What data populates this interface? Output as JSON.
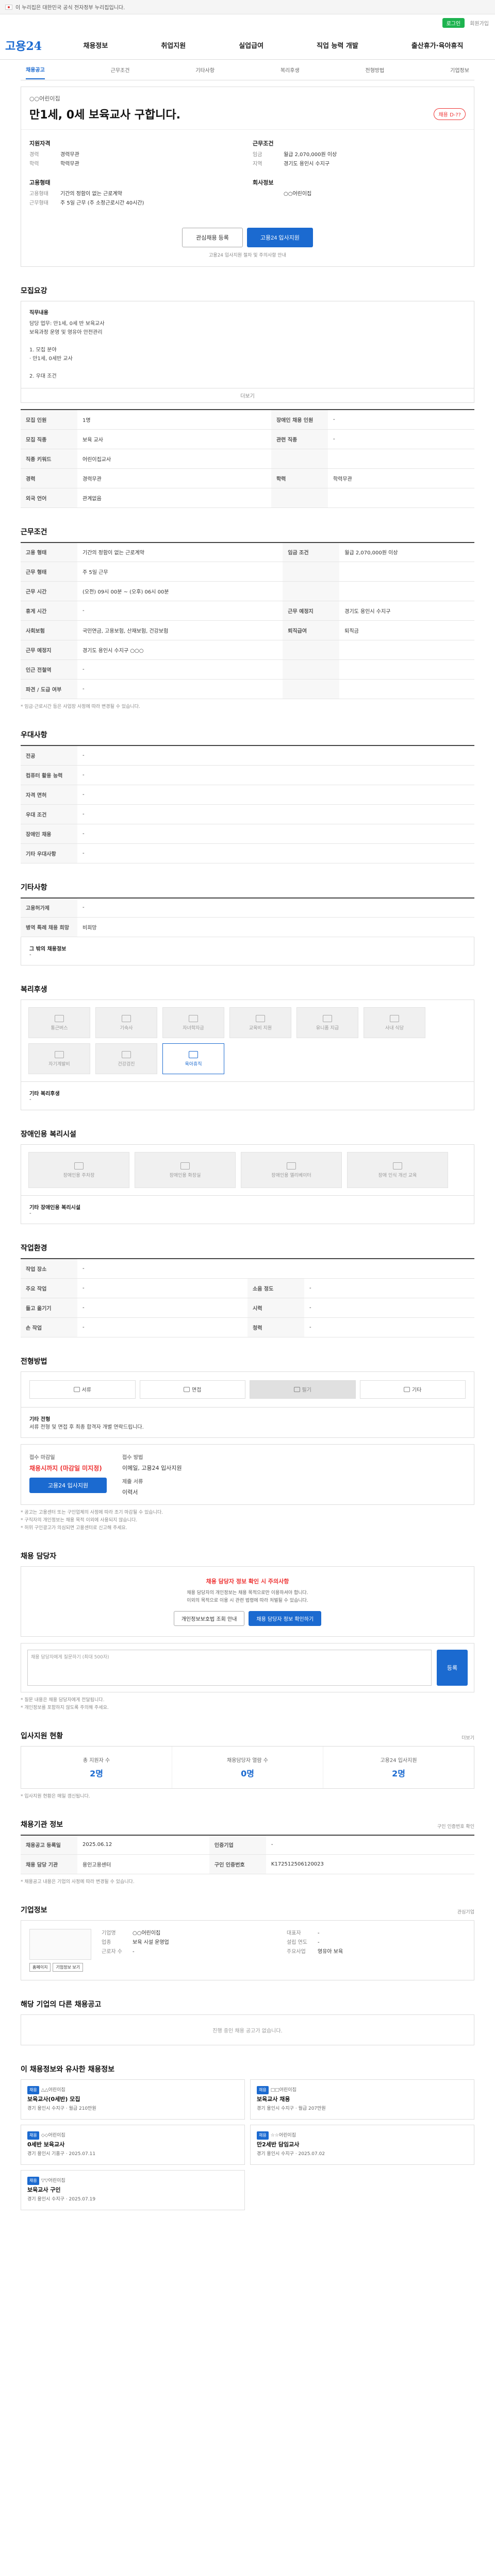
{
  "topbar": {
    "text": "이 누리집은 대한민국 공식 전자정부 누리집입니다."
  },
  "subtop": {
    "login": "로그인",
    "join": "회원가입"
  },
  "gnb": {
    "logo": "고용24",
    "menu": [
      "채용정보",
      "취업지원",
      "실업급여",
      "직업 능력 개발",
      "출산휴가·육아휴직"
    ]
  },
  "tabs": [
    "채용공고",
    "근무조건",
    "기타사항",
    "복리후생",
    "전형방법",
    "기업정보"
  ],
  "head": {
    "company": "○○어린이집",
    "title": "만1세, 0세 보육교사 구합니다.",
    "dday": "채용 D-??",
    "left_title": "지원자격",
    "left": [
      {
        "k": "경력",
        "v": "경력무관"
      },
      {
        "k": "학력",
        "v": "학력무관"
      }
    ],
    "left_title2": "고용형태",
    "left2": [
      {
        "k": "고용형태",
        "v": "기간의 정함이 없는 근로계약"
      },
      {
        "k": "근무형태",
        "v": "주 5일 근무 (주 소정근로시간 40시간)"
      }
    ],
    "right_title": "근무조건",
    "right": [
      {
        "k": "임금",
        "v": "월급 2,070,000원 이상"
      },
      {
        "k": "지역",
        "v": "경기도 용인시 수지구"
      }
    ],
    "right_title2": "회사정보",
    "right2": [
      {
        "k": "",
        "v": "○○어린이집"
      }
    ],
    "btn_interest": "관심채용 등록",
    "btn_apply": "고용24 입사지원",
    "notice": "고용24 입사지원 절차 및 주의사항 안내"
  },
  "recruit": {
    "title": "모집요강",
    "content_label": "직무내용",
    "content": [
      "담당 업무: 만1세, 0세 반 보육교사",
      "보육과정 운영 및 영유아 안전관리",
      "",
      "1. 모집 분야",
      "  · 만1세, 0세반 교사",
      "",
      "2. 우대 조건"
    ],
    "more": "더보기",
    "rows": [
      [
        {
          "th": "모집 인원",
          "td": "1명"
        },
        {
          "th": "장애인 채용 인원",
          "td": "-"
        }
      ],
      [
        {
          "th": "모집 직종",
          "td": "보육 교사"
        },
        {
          "th": "관련 직종",
          "td": "-"
        }
      ],
      [
        {
          "th": "직종 키워드",
          "td": "어린이집교사"
        },
        {
          "th": "",
          "td": ""
        }
      ],
      [
        {
          "th": "경력",
          "td": "경력무관"
        },
        {
          "th": "학력",
          "td": "학력무관"
        }
      ],
      [
        {
          "th": "외국 언어",
          "td": "관계없음"
        },
        {
          "th": "",
          "td": ""
        }
      ]
    ]
  },
  "conditions": {
    "title": "근무조건",
    "rows": [
      [
        {
          "th": "고용 형태",
          "td": "기간의 정함이 없는 근로계약"
        },
        {
          "th": "임금 조건",
          "td": "월급 2,070,000원 이상"
        }
      ],
      [
        {
          "th": "근무 형태",
          "td": "주 5일 근무"
        },
        {
          "th": "",
          "td": ""
        }
      ],
      [
        {
          "th": "근무 시간",
          "td": "(오전) 09시 00분 ~ (오후) 06시 00분"
        },
        {
          "th": "",
          "td": ""
        }
      ],
      [
        {
          "th": "휴게 시간",
          "td": "-"
        },
        {
          "th": "근무 예정지",
          "td": "경기도 용인시 수지구"
        }
      ],
      [
        {
          "th": "사회보험",
          "td": "국민연금, 고용보험, 산재보험, 건강보험"
        },
        {
          "th": "퇴직급여",
          "td": "퇴직금"
        }
      ],
      [
        {
          "th": "근무 예정지",
          "td": "경기도 용인시 수지구 ○○○"
        },
        {
          "th": "",
          "td": ""
        }
      ],
      [
        {
          "th": "인근 전철역",
          "td": "-"
        },
        {
          "th": "",
          "td": ""
        }
      ],
      [
        {
          "th": "파견 / 도급 여부",
          "td": "-"
        },
        {
          "th": "",
          "td": ""
        }
      ]
    ],
    "tag": "주 5일 근무",
    "note": "주 소정근로시간 40시간",
    "footnote": "* 임금·근로시간 등은 사업장 사정에 따라 변경될 수 있습니다."
  },
  "etc": {
    "title": "우대사항",
    "rows": [
      [
        {
          "th": "전공",
          "td": "-"
        }
      ],
      [
        {
          "th": "컴퓨터 활용 능력",
          "td": "-"
        }
      ],
      [
        {
          "th": "자격 면허",
          "td": "-"
        }
      ],
      [
        {
          "th": "우대 조건",
          "td": "-"
        }
      ],
      [
        {
          "th": "장애인 채용",
          "td": "-"
        }
      ],
      [
        {
          "th": "기타 우대사항",
          "td": "-"
        }
      ]
    ]
  },
  "other": {
    "title": "기타사항",
    "rows": [
      [
        {
          "th": "고용허가제",
          "td": "-"
        }
      ],
      [
        {
          "th": "병역 특례 채용 희망",
          "td": "비희망"
        }
      ]
    ],
    "subtitle": "그 밖의 채용정보",
    "subvalue": "-"
  },
  "welfare": {
    "title": "복리후생",
    "tiles": [
      "통근버스",
      "기숙사",
      "자녀학자금",
      "교육비 지원",
      "유니폼 지급",
      "사내 식당",
      "자기계발비",
      "건강검진",
      "육아휴직"
    ],
    "active_index": 8,
    "extra_label": "기타 복리후생",
    "extra_value": "-"
  },
  "disabled": {
    "title": "장애인용 복리시설",
    "tiles": [
      "장애인용 주차장",
      "장애인용 화장실",
      "장애인용 엘리베이터",
      "장애 인식 개선 교육"
    ],
    "note_label": "기타 장애인용 복리시설",
    "note_value": "-"
  },
  "env": {
    "title": "작업환경",
    "rows": [
      [
        {
          "th": "작업 장소",
          "td": "-"
        }
      ],
      [
        {
          "th": "주요 작업",
          "td": "-"
        },
        {
          "th": "소음 정도",
          "td": "-"
        }
      ],
      [
        {
          "th": "들고 옮기기",
          "td": "-"
        },
        {
          "th": "시력",
          "td": "-"
        }
      ],
      [
        {
          "th": "손 작업",
          "td": "-"
        },
        {
          "th": "청력",
          "td": "-"
        }
      ]
    ]
  },
  "process": {
    "title": "전형방법",
    "steps": [
      "서류",
      "면접",
      "필기",
      "기타"
    ],
    "current": 2,
    "method_label": "기타 전형",
    "method_value": "서류 전형 및 면접 후 최종 합격자 개별 연락드립니다.",
    "apply_label": "접수 마감일",
    "apply_date": "채용시까지 (마감일 미지정)",
    "apply_method_label": "접수 방법",
    "apply_method": "이메일, 고용24 입사지원",
    "doc_label": "제출 서류",
    "doc_value": "이력서",
    "apply_btn": "고용24 입사지원",
    "notes": [
      "* 공고는 고용센터 또는 구인업체의 사정에 따라 조기 마감될 수 있습니다.",
      "* 구직자의 개인정보는 채용 목적 이외에 사용되지 않습니다.",
      "* 허위 구인광고가 의심되면 고용센터로 신고해 주세요."
    ]
  },
  "manager": {
    "title": "채용 담당자",
    "warn": "채용 담당자 정보 확인 시 주의사항",
    "desc": [
      "채용 담당자의 개인정보는 채용 목적으로만 이용하셔야 합니다.",
      "이외의 목적으로 이용 시 관련 법령에 따라 처벌될 수 있습니다."
    ],
    "btn1": "개인정보보호법 조회 안내",
    "btn2": "채용 담당자 정보 확인하기"
  },
  "qa": {
    "placeholder": "채용 담당자에게 질문하기 (최대 500자)",
    "send": "등록",
    "notes": [
      "* 질문 내용은 채용 담당자에게 전달됩니다.",
      "* 개인정보를 포함하지 않도록 주의해 주세요."
    ]
  },
  "status": {
    "title": "입사지원 현황",
    "more": "더보기",
    "items": [
      {
        "lbl": "총 지원자 수",
        "num": "2명"
      },
      {
        "lbl": "채용담당자 열람 수",
        "num": "0명"
      },
      {
        "lbl": "고용24 입사지원",
        "num": "2명"
      }
    ],
    "footnote": "* 입사지원 현황은 매일 갱신됩니다."
  },
  "meta": {
    "title": "채용기관 정보",
    "more": "구인 인증번호 확인",
    "rows": [
      [
        {
          "th": "채용공고 등록일",
          "td": "2025.06.12"
        },
        {
          "th": "인증기업",
          "td": "-"
        }
      ],
      [
        {
          "th": "채용 담당 기관",
          "td": "용인고용센터"
        },
        {
          "th": "구인 인증번호",
          "td": "K172512506120023"
        }
      ]
    ],
    "footnote": "* 채용공고 내용은 기업의 사정에 따라 변경될 수 있습니다."
  },
  "corp": {
    "title": "기업정보",
    "btn_home": "홈페이지",
    "btn_more": "기업정보 보기",
    "btn_fav": "관심기업",
    "cols": [
      [
        {
          "k": "기업명",
          "v": "○○어린이집"
        },
        {
          "k": "업종",
          "v": "보육 시설 운영업"
        },
        {
          "k": "근로자 수",
          "v": "-"
        }
      ],
      [
        {
          "k": "대표자",
          "v": "-"
        },
        {
          "k": "설립 연도",
          "v": "-"
        },
        {
          "k": "주요사업",
          "v": "영유아 보육"
        }
      ]
    ]
  },
  "related": {
    "title": "해당 기업의 다른 채용공고",
    "empty": "진행 중인 채용 공고가 없습니다."
  },
  "recommend": {
    "title": "이 채용정보와 유사한 채용정보",
    "cards": [
      {
        "badge": "채용",
        "name": "△△어린이집",
        "ttl": "보육교사(0세반) 모집",
        "meta": "경기 용인시 수지구 · 월급 210만원"
      },
      {
        "badge": "채용",
        "name": "□□어린이집",
        "ttl": "보육교사 채용",
        "meta": "경기 용인시 수지구 · 월급 207만원"
      },
      {
        "badge": "채용",
        "name": "◇◇어린이집",
        "ttl": "0세반 보육교사",
        "meta": "경기 용인시 기흥구 · 2025.07.11"
      },
      {
        "badge": "채용",
        "name": "☆☆어린이집",
        "ttl": "만2세반 담임교사",
        "meta": "경기 용인시 수지구 · 2025.07.02"
      },
      {
        "badge": "채용",
        "name": "▽▽어린이집",
        "ttl": "보육교사 구인",
        "meta": "경기 용인시 수지구 · 2025.07.19"
      }
    ]
  }
}
